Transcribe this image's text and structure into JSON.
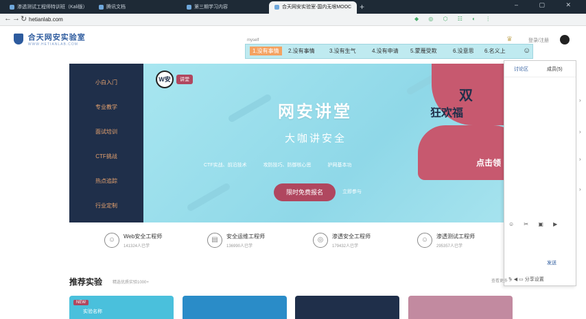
{
  "browser": {
    "tabs": [
      {
        "label": "渗透测试工程师特训班（Kali版）"
      },
      {
        "label": "腾讯文档"
      },
      {
        "label": "第三期学习内容"
      },
      {
        "label": "合天网安实验室-国内无垠MOOC",
        "active": true
      }
    ],
    "new_tab": "+",
    "window_controls": "– ▢ ✕",
    "url": "hetianlab.com",
    "nav": {
      "back": "←",
      "forward": "→",
      "reload": "↻"
    }
  },
  "site": {
    "logo_title": "合天网安实验室",
    "logo_sub": "WWW.HETIANLAB.COM",
    "user_text": "登录/注册",
    "chat_label": "myself",
    "chat_messages": [
      "1.没有事情",
      "2.没有事情",
      "3.没有生气",
      "4.没有申请",
      "5.蒙蔑受欺",
      "6.没意思",
      "6.名义上"
    ],
    "chat_emoji": "☺"
  },
  "sidebar": {
    "items": [
      "小白入门",
      "专业教学",
      "面试培训",
      "CTF挑战",
      "热点追踪",
      "行业定制"
    ]
  },
  "banner": {
    "brand": "W安",
    "brand_tag": "讲堂",
    "title": "网安讲堂",
    "subtitle": "大咖讲安全",
    "features": [
      "CTF实战、前沿技术",
      "攻防技巧、防御核心思",
      "护网基本功"
    ],
    "cta": "限时免费报名",
    "cta_secondary": "立即参与",
    "promo_line1": "双",
    "promo_line2": "狂欢福",
    "promo_click": "点击领"
  },
  "chat_panel": {
    "tabs": [
      "讨论区",
      "成员(5)"
    ],
    "tools": "☺ ✂ ▣ ▶",
    "send": "发送",
    "footer": "✎ ◀ ▭ 分享设置"
  },
  "tracks": [
    {
      "name": "Web安全工程师",
      "count": "141324人已学",
      "icon": "☺"
    },
    {
      "name": "安全运维工程师",
      "count": "136990人已学",
      "icon": "▤"
    },
    {
      "name": "渗透安全工程师",
      "count": "179432人已学",
      "icon": "◎"
    },
    {
      "name": "渗透测试工程师",
      "count": "295357人已学",
      "icon": "☺"
    }
  ],
  "recommend": {
    "title": "推荐实验",
    "subtitle": "精选优质实验1000+",
    "more": "查看更多 >"
  },
  "cards": [
    {
      "tag": "NEW",
      "text": "实验名称",
      "color": "#4ac0dc"
    },
    {
      "tag": "",
      "text": "",
      "color": "#2a8cc8"
    },
    {
      "tag": "",
      "text": "",
      "color": "#1f2f4a"
    },
    {
      "tag": "",
      "text": "",
      "color": "#c28aa0"
    }
  ],
  "colors": {
    "accent": "#b0475f",
    "sidebar": "#1f2f4a",
    "brand": "#2d5b9e"
  }
}
